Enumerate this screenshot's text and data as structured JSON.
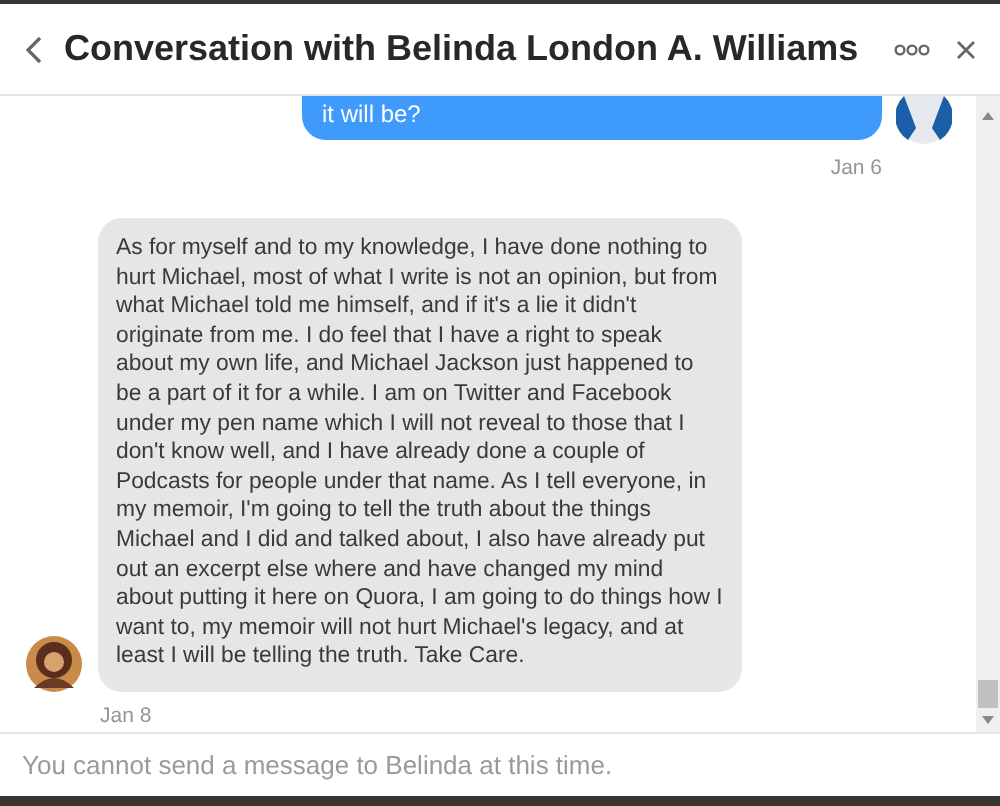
{
  "dialog": {
    "title": "Conversation with Belinda London A. Williams"
  },
  "messages": [
    {
      "kind": "sent",
      "text": "it will be?",
      "date": "Jan 6"
    },
    {
      "kind": "received",
      "text": "As for myself and to my knowledge, I have done nothing to hurt Michael, most of what I write is not an opinion, but from what Michael told me himself, and if it's a lie it didn't originate from me. I do feel that I have a right to speak about my own life, and Michael Jackson just happened to be a part of it for a while. I am on Twitter and Facebook under my pen name which I will not reveal to those that I don't know well, and I have already done a couple of Podcasts for people under that name. As I tell everyone, in my memoir, I'm going to tell the truth about the things Michael and I did and talked about, I also have already put out an excerpt else where and have changed my mind about putting it here on Quora, I am going to do things how I want to, my memoir will not hurt Michael's legacy, and at least I will be telling the truth. Take Care.",
      "date": "Jan 8"
    }
  ],
  "composer": {
    "placeholder": "You cannot send a message to Belinda at this time."
  }
}
